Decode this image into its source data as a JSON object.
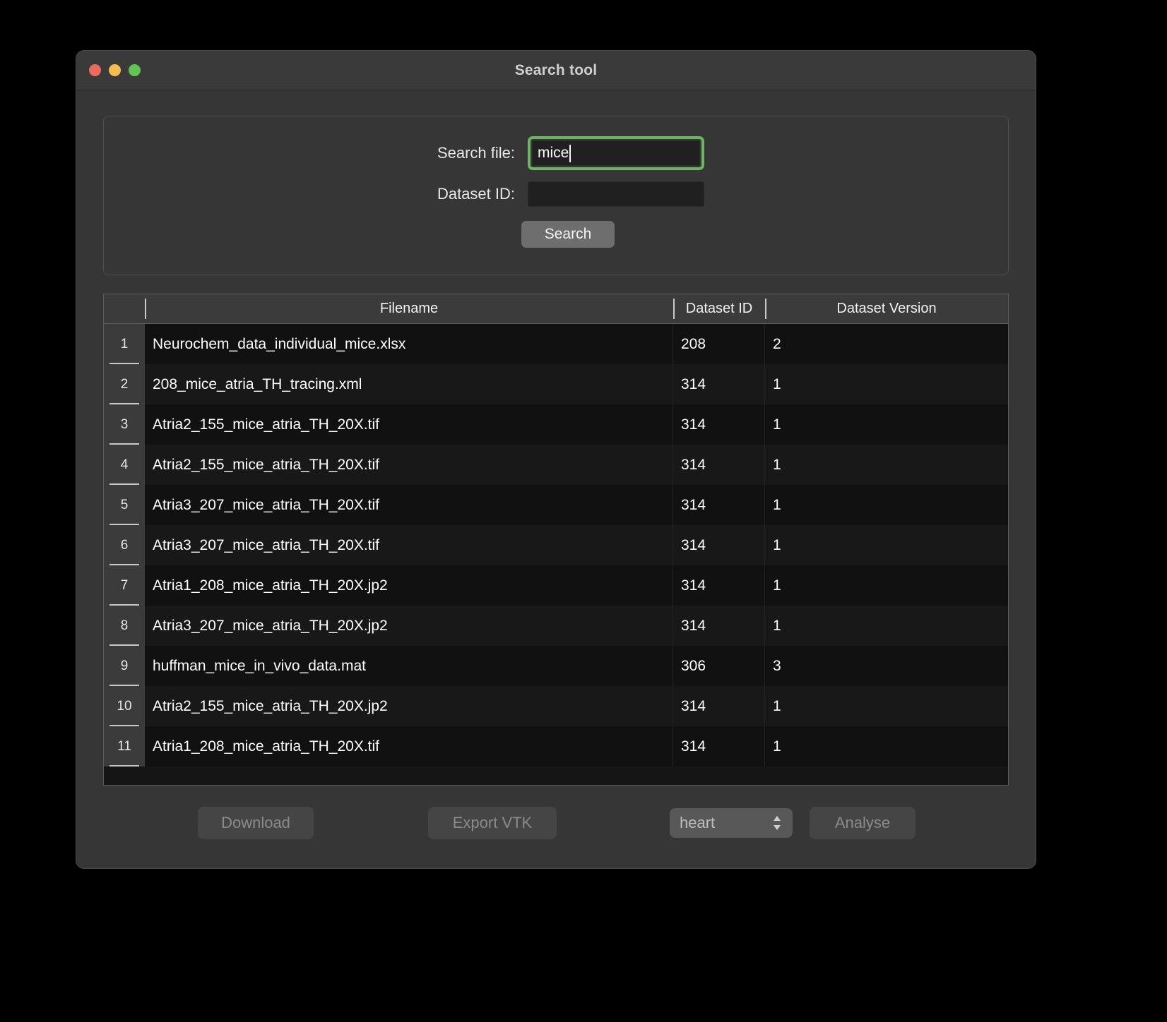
{
  "window": {
    "title": "Search tool",
    "controls": [
      {
        "name": "close",
        "color": "#ed6a5e"
      },
      {
        "name": "minimize",
        "color": "#f5bd4f"
      },
      {
        "name": "zoom",
        "color": "#61c454"
      }
    ]
  },
  "search_panel": {
    "file_label": "Search file:",
    "file_value": "mice",
    "file_placeholder": "",
    "dataset_label": "Dataset ID:",
    "dataset_value": "",
    "dataset_placeholder": "",
    "search_button": "Search",
    "focus_color": "#6fb364"
  },
  "table": {
    "columns": [
      "",
      "Filename",
      "Dataset ID",
      "Dataset Version"
    ],
    "rows": [
      {
        "n": "1",
        "filename": "Neurochem_data_individual_mice.xlsx",
        "dataset_id": "208",
        "dataset_version": "2"
      },
      {
        "n": "2",
        "filename": "208_mice_atria_TH_tracing.xml",
        "dataset_id": "314",
        "dataset_version": "1"
      },
      {
        "n": "3",
        "filename": "Atria2_155_mice_atria_TH_20X.tif",
        "dataset_id": "314",
        "dataset_version": "1"
      },
      {
        "n": "4",
        "filename": "Atria2_155_mice_atria_TH_20X.tif",
        "dataset_id": "314",
        "dataset_version": "1"
      },
      {
        "n": "5",
        "filename": "Atria3_207_mice_atria_TH_20X.tif",
        "dataset_id": "314",
        "dataset_version": "1"
      },
      {
        "n": "6",
        "filename": "Atria3_207_mice_atria_TH_20X.tif",
        "dataset_id": "314",
        "dataset_version": "1"
      },
      {
        "n": "7",
        "filename": "Atria1_208_mice_atria_TH_20X.jp2",
        "dataset_id": "314",
        "dataset_version": "1"
      },
      {
        "n": "8",
        "filename": "Atria3_207_mice_atria_TH_20X.jp2",
        "dataset_id": "314",
        "dataset_version": "1"
      },
      {
        "n": "9",
        "filename": "huffman_mice_in_vivo_data.mat",
        "dataset_id": "306",
        "dataset_version": "3"
      },
      {
        "n": "10",
        "filename": "Atria2_155_mice_atria_TH_20X.jp2",
        "dataset_id": "314",
        "dataset_version": "1"
      },
      {
        "n": "11",
        "filename": "Atria1_208_mice_atria_TH_20X.tif",
        "dataset_id": "314",
        "dataset_version": "1"
      }
    ]
  },
  "footer": {
    "download_label": "Download",
    "export_label": "Export VTK",
    "organ_selected": "heart",
    "analyse_label": "Analyse"
  }
}
